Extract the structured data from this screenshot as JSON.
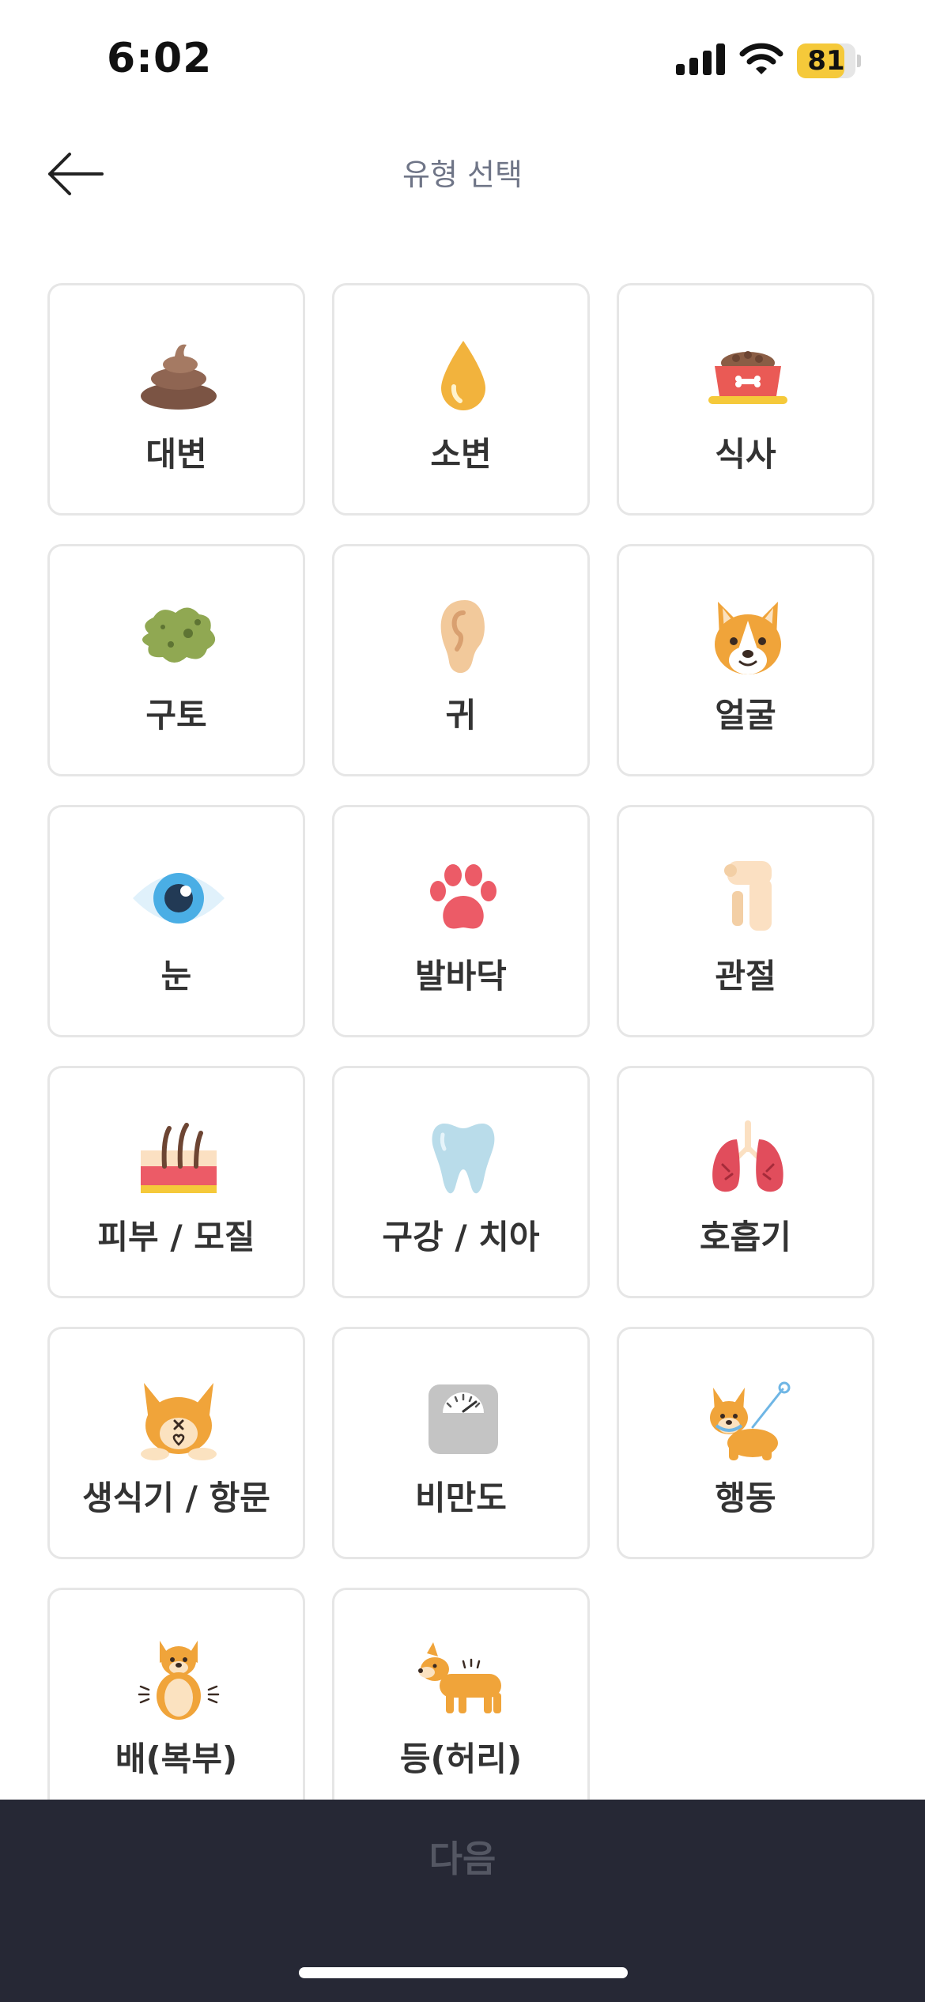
{
  "status_bar": {
    "time": "6:02",
    "battery": "81",
    "battery_level": 0.81
  },
  "header": {
    "title": "유형 선택"
  },
  "items": [
    {
      "label": "대변",
      "icon": "poop-icon"
    },
    {
      "label": "소변",
      "icon": "urine-drop-icon"
    },
    {
      "label": "식사",
      "icon": "food-bowl-icon"
    },
    {
      "label": "구토",
      "icon": "vomit-icon"
    },
    {
      "label": "귀",
      "icon": "ear-icon"
    },
    {
      "label": "얼굴",
      "icon": "dog-face-icon"
    },
    {
      "label": "눈",
      "icon": "eye-icon"
    },
    {
      "label": "발바닥",
      "icon": "paw-icon"
    },
    {
      "label": "관절",
      "icon": "joint-icon"
    },
    {
      "label": "피부 / 모질",
      "icon": "skin-hair-icon"
    },
    {
      "label": "구강 / 치아",
      "icon": "tooth-icon"
    },
    {
      "label": "호흡기",
      "icon": "lungs-icon"
    },
    {
      "label": "생식기 / 항문",
      "icon": "dog-rear-icon"
    },
    {
      "label": "비만도",
      "icon": "scale-icon"
    },
    {
      "label": "행동",
      "icon": "dog-leash-icon"
    },
    {
      "label": "배(복부)",
      "icon": "dog-belly-icon"
    },
    {
      "label": "등(허리)",
      "icon": "dog-back-icon"
    }
  ],
  "footer": {
    "next_label": "다음"
  },
  "colors": {
    "footer_bg": "#262835",
    "card_border": "#e6e6e6",
    "title": "#6f7587",
    "battery": "#f5c93a"
  }
}
